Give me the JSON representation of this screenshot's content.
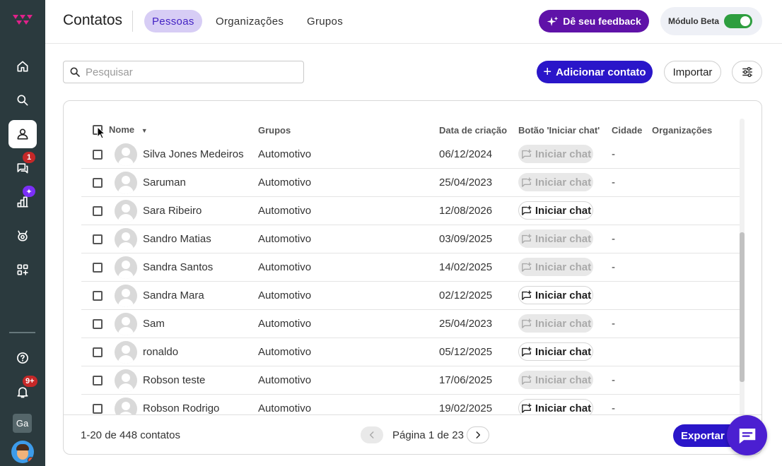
{
  "sidebar": {
    "badges": {
      "messages": "1",
      "reports": "✦",
      "notifications": "9+"
    },
    "workspace_initials": "Ga"
  },
  "header": {
    "title": "Contatos",
    "tabs": [
      {
        "label": "Pessoas",
        "active": true
      },
      {
        "label": "Organizações",
        "active": false
      },
      {
        "label": "Grupos",
        "active": false
      }
    ],
    "feedback_label": "Dê seu feedback",
    "beta_label": "Módulo Beta",
    "beta_enabled": true
  },
  "toolbar": {
    "search_placeholder": "Pesquisar",
    "add_contact_label": "Adicionar contato",
    "import_label": "Importar"
  },
  "table": {
    "columns": {
      "name": "Nome",
      "groups": "Grupos",
      "created": "Data de criação",
      "chat": "Botão 'Iniciar chat'",
      "city": "Cidade",
      "orgs": "Organizações"
    },
    "chat_label": "Iniciar chat",
    "rows": [
      {
        "name": "Silva Jones Medeiros",
        "group": "Automotivo",
        "date": "06/12/2024",
        "chat_enabled": false,
        "city": "-"
      },
      {
        "name": "Saruman",
        "group": "Automotivo",
        "date": "25/04/2023",
        "chat_enabled": false,
        "city": "-"
      },
      {
        "name": "Sara Ribeiro",
        "group": "Automotivo",
        "date": "12/08/2026",
        "chat_enabled": true,
        "city": ""
      },
      {
        "name": "Sandro Matias",
        "group": "Automotivo",
        "date": "03/09/2025",
        "chat_enabled": false,
        "city": "-"
      },
      {
        "name": "Sandra Santos",
        "group": "Automotivo",
        "date": "14/02/2025",
        "chat_enabled": false,
        "city": "-"
      },
      {
        "name": "Sandra Mara",
        "group": "Automotivo",
        "date": "02/12/2025",
        "chat_enabled": true,
        "city": ""
      },
      {
        "name": "Sam",
        "group": "Automotivo",
        "date": "25/04/2023",
        "chat_enabled": false,
        "city": "-"
      },
      {
        "name": "ronaldo",
        "group": "Automotivo",
        "date": "05/12/2025",
        "chat_enabled": true,
        "city": ""
      },
      {
        "name": "Robson teste",
        "group": "Automotivo",
        "date": "17/06/2025",
        "chat_enabled": false,
        "city": "-"
      },
      {
        "name": "Robson Rodrigo",
        "group": "Automotivo",
        "date": "19/02/2025",
        "chat_enabled": true,
        "city": "-"
      }
    ]
  },
  "footer": {
    "count_text": "1-20 de 448 contatos",
    "page_text": "Página 1 de 23",
    "export_label": "Exportar"
  },
  "colors": {
    "sidebar": "#2b3a3e",
    "primary": "#2a16c9",
    "feedback": "#5f12a8",
    "tab_active_bg": "#d7cdf5",
    "toggle_on": "#2e9e3f",
    "badge": "#c62828"
  }
}
